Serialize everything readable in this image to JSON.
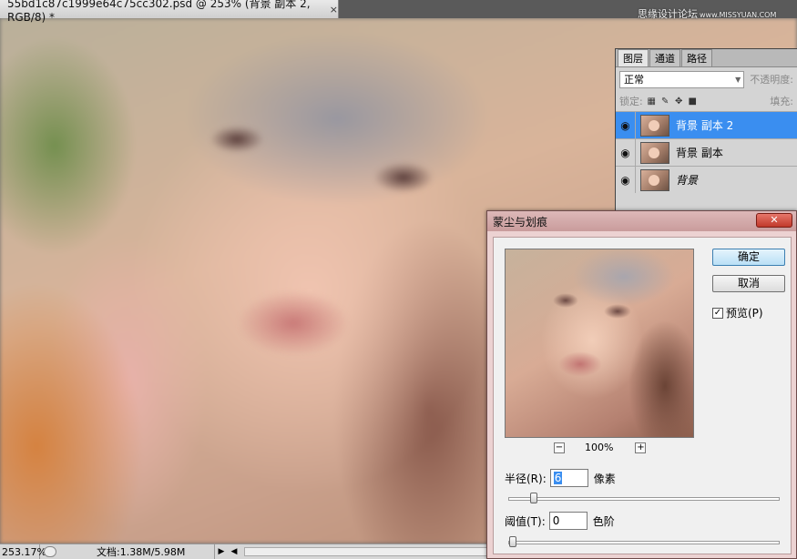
{
  "document": {
    "tab_title": "55bd1c87c1999e64c75cc302.psd @ 253% (背景 副本 2, RGB/8) *",
    "close_glyph": "×",
    "watermark": "思缘设计论坛",
    "watermark_url": "www.MISSYUAN.COM"
  },
  "status_bar": {
    "zoom": "253.17%",
    "doc_info": "文档:1.38M/5.98M",
    "play_glyph": "▶",
    "scroll_left_glyph": "◀"
  },
  "layers_panel": {
    "tabs": [
      {
        "label": "图层",
        "active": true
      },
      {
        "label": "通道",
        "active": false
      },
      {
        "label": "路径",
        "active": false
      }
    ],
    "blend_mode": "正常",
    "opacity_label": "不透明度:",
    "lock_label": "锁定:",
    "fill_label": "填充:",
    "layers": [
      {
        "name": "背景 副本 2",
        "selected": true,
        "italic": false
      },
      {
        "name": "背景 副本",
        "selected": false,
        "italic": false
      },
      {
        "name": "背景",
        "selected": false,
        "italic": true
      }
    ]
  },
  "dialog": {
    "title": "蒙尘与划痕",
    "close_glyph": "✕",
    "preview_zoom": "100%",
    "zoom_out_glyph": "−",
    "zoom_in_glyph": "+",
    "ok_label": "确定",
    "cancel_label": "取消",
    "preview_label": "预览(P)",
    "preview_checked": true,
    "radius_label": "半径(R):",
    "radius_value": "6",
    "radius_unit": "像素",
    "radius_slider_fraction": 0.08,
    "threshold_label": "阈值(T):",
    "threshold_value": "0",
    "threshold_unit": "色阶",
    "threshold_slider_fraction": 0.0
  },
  "icons": {
    "eye": "eye-icon",
    "lock_transparent": "lock-transparency-icon",
    "lock_paint": "lock-paint-icon",
    "lock_move": "lock-position-icon",
    "lock_all": "lock-all-icon"
  }
}
